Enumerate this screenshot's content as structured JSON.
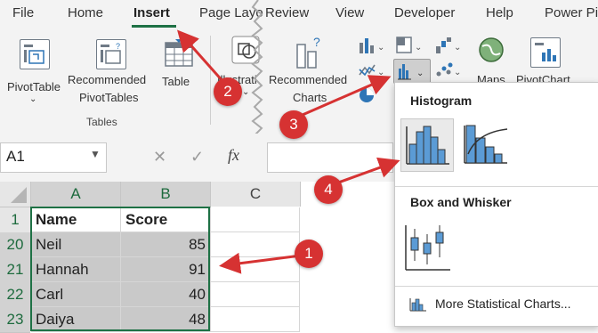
{
  "tabs": [
    "File",
    "Home",
    "Insert",
    "Page Layo",
    "Review",
    "View",
    "Developer",
    "Help",
    "Power Pi"
  ],
  "ribbon": {
    "pivottable": "PivotTable",
    "recommended_pivot_line1": "Recommended",
    "recommended_pivot_line2": "PivotTables",
    "table": "Table",
    "tables_group": "Tables",
    "illustrations": "Illustrati",
    "recommended_charts_line1": "Recommended",
    "recommended_charts_line2": "Charts",
    "maps": "Maps",
    "pivotchart": "PivotChart"
  },
  "formula_bar": {
    "name_box": "A1",
    "fx": "fx"
  },
  "columns": [
    "A",
    "B",
    "C"
  ],
  "rows": [
    {
      "num": "1",
      "name": "Name",
      "score": "Score"
    },
    {
      "num": "20",
      "name": "Neil",
      "score": "85"
    },
    {
      "num": "21",
      "name": "Hannah",
      "score": "91"
    },
    {
      "num": "22",
      "name": "Carl",
      "score": "40"
    },
    {
      "num": "23",
      "name": "Daiya",
      "score": "48"
    }
  ],
  "dropdown": {
    "histogram_title": "Histogram",
    "box_whisker_title": "Box and Whisker",
    "more": "More Statistical Charts..."
  },
  "callouts": [
    "1",
    "2",
    "3",
    "4"
  ],
  "colors": {
    "accent_green": "#1e7145",
    "callout_red": "#d63232",
    "chart_blue": "#5b9bd5"
  }
}
